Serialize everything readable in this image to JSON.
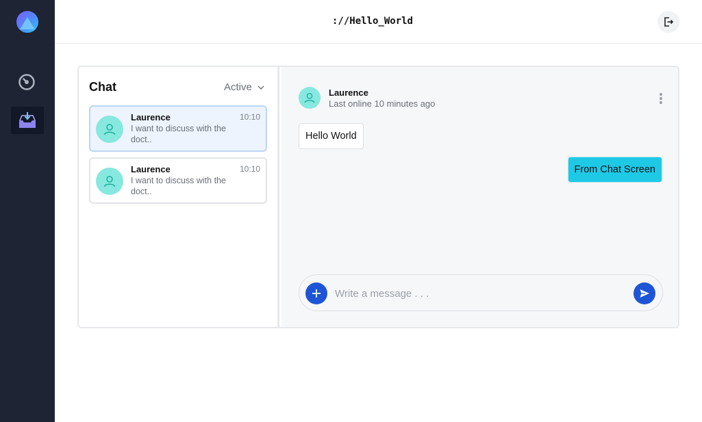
{
  "app": {
    "title": "://Hello_World"
  },
  "sidebar": {
    "items": [
      {
        "icon": "dashboard-icon"
      },
      {
        "icon": "inbox-icon",
        "active": true
      }
    ]
  },
  "chat_list": {
    "heading": "Chat",
    "filter": "Active",
    "items": [
      {
        "name": "Laurence",
        "time": "10:10",
        "preview": "I want to discuss with the doct..",
        "active": true
      },
      {
        "name": "Laurence",
        "time": "10:10",
        "preview": "I want to discuss with the doct..",
        "active": false
      }
    ]
  },
  "conversation": {
    "contact_name": "Laurence",
    "status": "Last online 10 minutes ago",
    "messages": [
      {
        "direction": "incoming",
        "text": "Hello World"
      },
      {
        "direction": "outgoing",
        "text": "From Chat Screen"
      }
    ],
    "composer_placeholder": "Write a message . . ."
  },
  "colors": {
    "sidebar_bg": "#1e2433",
    "accent": "#1e55d6",
    "outgoing_bubble": "#1ec9e6",
    "avatar_bg": "#87e8df"
  }
}
